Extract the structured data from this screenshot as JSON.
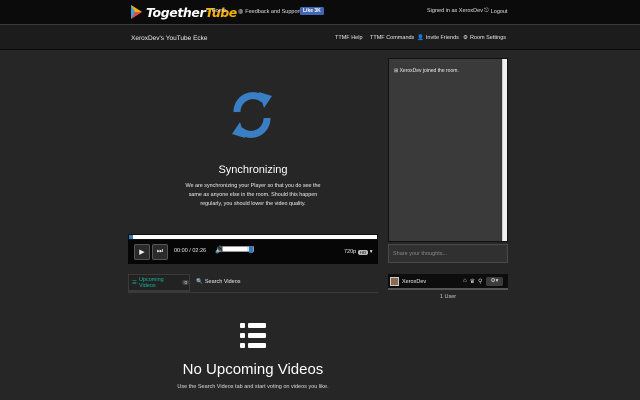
{
  "topbar": {
    "logo": {
      "part1": "Together",
      "part2": "Tube"
    },
    "nav": {
      "home": "Home",
      "feedback": "Feedback and Support",
      "like": "Like 3K",
      "signed_in": "Signed in as XeroxDev",
      "logout": "Logout"
    }
  },
  "room": {
    "title": "XeroxDev's YouTube Ecke",
    "nav": {
      "ttmf_help": "TTMF Help",
      "ttmf_commands": "TTMF Commands",
      "invite": "Invite Friends",
      "settings": "Room Settings"
    }
  },
  "player": {
    "sync_title": "Synchronizing",
    "sync_text": "We are synchronizing your Player so that you do see the same as anyone else in the room. Should this happen regularly, you should lower the video quality.",
    "timecode": "00:00 / 02:26",
    "quality": "720p",
    "quality_badge": "HD",
    "progress": 0.015,
    "volume": 0.8
  },
  "tabs": {
    "upcoming": "Upcoming Videos",
    "upcoming_count": "0",
    "search": "Search Videos"
  },
  "empty": {
    "title": "No Upcoming Videos",
    "text": "Use the Search Videos tab and start voting on videos you like."
  },
  "chat": {
    "message": "XeroxDev joined the room.",
    "placeholder": "Share your thoughts..."
  },
  "users": {
    "name": "XeroxDev",
    "count": "1 User"
  },
  "colors": {
    "accent": "#2f7cc1",
    "brand_yellow": "#f4b000",
    "tab_active": "#19b3a0"
  }
}
